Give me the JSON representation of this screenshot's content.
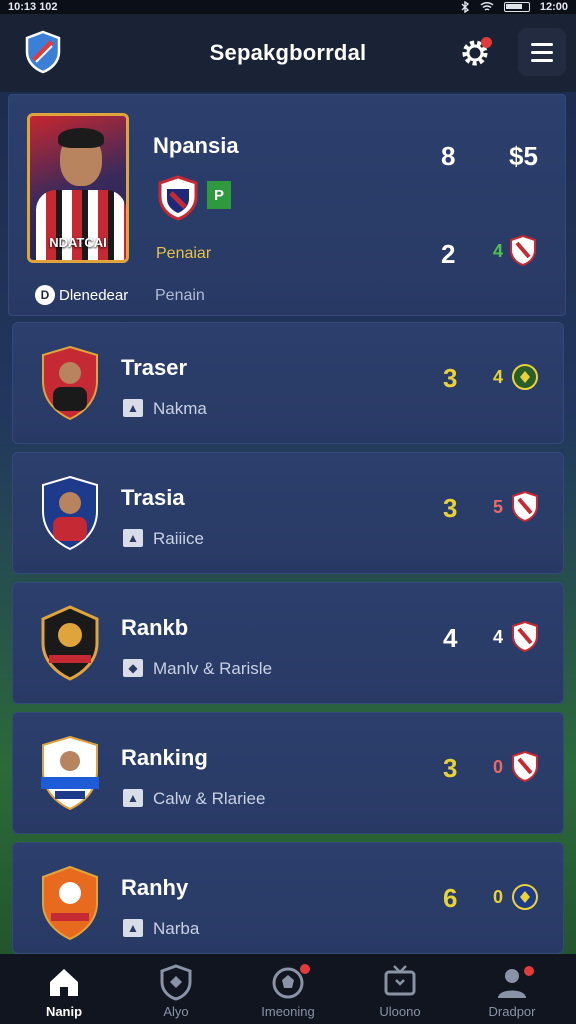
{
  "status_bar": {
    "left_text": "10:13 102",
    "right_text": "12:00"
  },
  "app": {
    "title": "Sepakgborrdal"
  },
  "featured": {
    "name": "Npansia",
    "shirt_text": "NDATCAI",
    "badge_letter": "P",
    "league": "Penaiar",
    "footer_icon": "D",
    "footer_left": "Dlenedear",
    "footer_right": "Penain",
    "stat_a": "8",
    "stat_b": "$5",
    "stat_c": "2",
    "stat_d": "4"
  },
  "rows": [
    {
      "name": "Traser",
      "sub": "Nakma",
      "score": "3",
      "score_color": "#e8d23a",
      "small": "4",
      "small_color": "#e8d23a"
    },
    {
      "name": "Trasia",
      "sub": "Raiiice",
      "score": "3",
      "score_color": "#e8d23a",
      "small": "5",
      "small_color": "#e86a6a"
    },
    {
      "name": "Rankb",
      "sub": "Manlv & Rarisle",
      "score": "4",
      "score_color": "#ffffff",
      "small": "4",
      "small_color": "#ffffff"
    },
    {
      "name": "Ranking",
      "sub": "Calw & Rlariee",
      "score": "3",
      "score_color": "#e8d23a",
      "small": "0",
      "small_color": "#e86a6a"
    },
    {
      "name": "Ranhy",
      "sub": "Narba",
      "score": "6",
      "score_color": "#e8d23a",
      "small": "0",
      "small_color": "#e8d23a"
    }
  ],
  "nav": [
    {
      "label": "Nanip",
      "icon": "home-icon"
    },
    {
      "label": "Alyo",
      "icon": "shield-icon"
    },
    {
      "label": "Imeoning",
      "icon": "ball-icon"
    },
    {
      "label": "Uloono",
      "icon": "tv-icon"
    },
    {
      "label": "Dradpor",
      "icon": "profile-icon"
    }
  ],
  "colors": {
    "accent": "#e0a43c",
    "card": "#2c3f6d",
    "nav_bg": "#11151f"
  }
}
